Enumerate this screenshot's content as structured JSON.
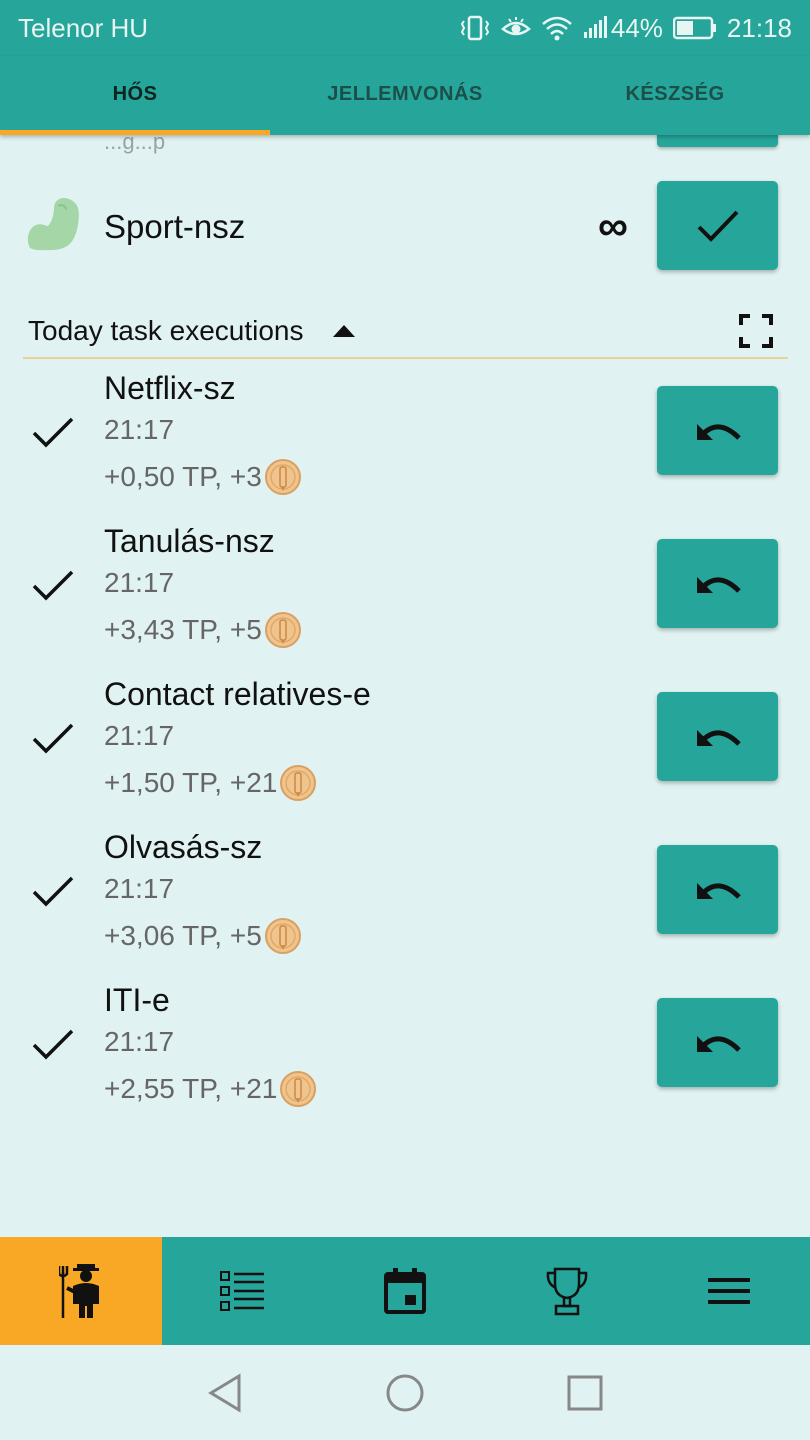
{
  "status_bar": {
    "carrier": "Telenor HU",
    "battery": "44%",
    "time": "21:18",
    "icons": [
      "vibrate-icon",
      "eye-icon",
      "wifi-icon",
      "signal-icon",
      "battery-icon"
    ]
  },
  "tabs": [
    {
      "label": "HŐS",
      "active": true
    },
    {
      "label": "JELLEMVONÁS",
      "active": false
    },
    {
      "label": "KÉSZSÉG",
      "active": false
    }
  ],
  "habit": {
    "name": "Sport-nsz",
    "repeat_symbol": "∞",
    "icon": "muscle-arm-icon",
    "cutoff_text": "...g...p"
  },
  "section": {
    "title": "Today task executions"
  },
  "executions": [
    {
      "name": "Netflix-sz",
      "time": "21:17",
      "reward": "+0,50 TP, +3"
    },
    {
      "name": "Tanulás-nsz",
      "time": "21:17",
      "reward": "+3,43 TP, +5"
    },
    {
      "name": "Contact relatives-e",
      "time": "21:17",
      "reward": "+1,50 TP, +21"
    },
    {
      "name": "Olvasás-sz",
      "time": "21:17",
      "reward": "+3,06 TP, +5"
    },
    {
      "name": "ITI-e",
      "time": "21:17",
      "reward": "+2,55 TP, +21"
    }
  ],
  "bottom_nav": [
    {
      "icon": "hero-farmer-icon",
      "active": true
    },
    {
      "icon": "task-list-icon",
      "active": false
    },
    {
      "icon": "calendar-icon",
      "active": false
    },
    {
      "icon": "trophy-icon",
      "active": false
    },
    {
      "icon": "menu-icon",
      "active": false
    }
  ],
  "colors": {
    "primary": "#26a69a",
    "accent": "#f9a825",
    "background": "#e0f2f1",
    "habit_icon": "#a5d6a7",
    "coin": "#e8b77a"
  }
}
